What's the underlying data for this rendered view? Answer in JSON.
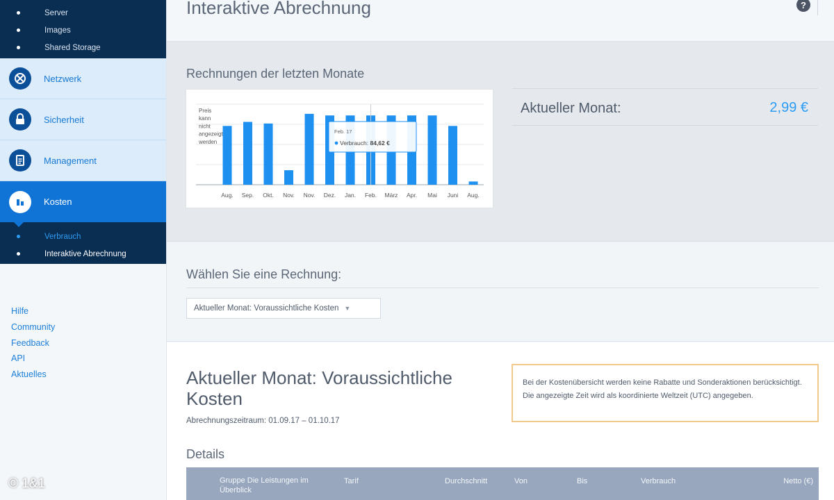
{
  "sidebar": {
    "sub_top": [
      "Server",
      "Images",
      "Shared Storage"
    ],
    "nav": [
      {
        "label": "Netzwerk",
        "icon": "network-icon"
      },
      {
        "label": "Sicherheit",
        "icon": "lock-icon"
      },
      {
        "label": "Management",
        "icon": "clipboard-icon"
      },
      {
        "label": "Kosten",
        "icon": "costs-icon"
      }
    ],
    "sub_kosten": [
      "Verbrauch",
      "Interaktive Abrechnung"
    ],
    "links": [
      "Hilfe",
      "Community",
      "Feedback",
      "API",
      "Aktuelles"
    ],
    "copyright": "© 1&1"
  },
  "header": {
    "title": "Interaktive Abrechnung",
    "help_icon": "?"
  },
  "chart_section": {
    "heading": "Rechnungen der letzten Monate",
    "current_label": "Aktueller Monat:",
    "current_value": "2,99 €"
  },
  "chart_data": {
    "type": "bar",
    "categories": [
      "Aug.",
      "Sep.",
      "Okt.",
      "Nov.",
      "Nov.",
      "Dez.",
      "Jan.",
      "Feb.",
      "März",
      "Apr.",
      "Mai",
      "Juni",
      "Aug."
    ],
    "values": [
      73,
      78,
      76,
      18,
      88,
      86,
      86,
      86,
      86,
      86,
      86,
      73,
      4
    ],
    "placeholder_note": [
      "Preis",
      "kann",
      "nicht",
      "angezeigt",
      "werden"
    ],
    "tooltip": {
      "title": "Feb. 17",
      "series": "Verbrauch",
      "value": "84,62 €",
      "index": 7
    },
    "bar_color": "#1e90f0",
    "grid": true
  },
  "select_section": {
    "heading": "Wählen Sie eine Rechnung:",
    "selected": "Aktueller Monat: Voraussichtliche Kosten"
  },
  "details": {
    "title": "Aktueller Monat: Voraussichtliche Kosten",
    "period": "Abrechnungszeitraum: 01.09.17 – 01.10.17",
    "notice": "Bei der Kostenübersicht werden keine Rabatte und Sonderaktionen berücksichtigt. Die angezeigte Zeit wird als koordinierte Weltzeit (UTC) angegeben.",
    "heading": "Details",
    "columns": [
      "Gruppe Die Leistungen im Überblick",
      "Tarif",
      "Durchschnitt",
      "Von",
      "Bis",
      "Verbrauch",
      "Netto (€)"
    ]
  }
}
